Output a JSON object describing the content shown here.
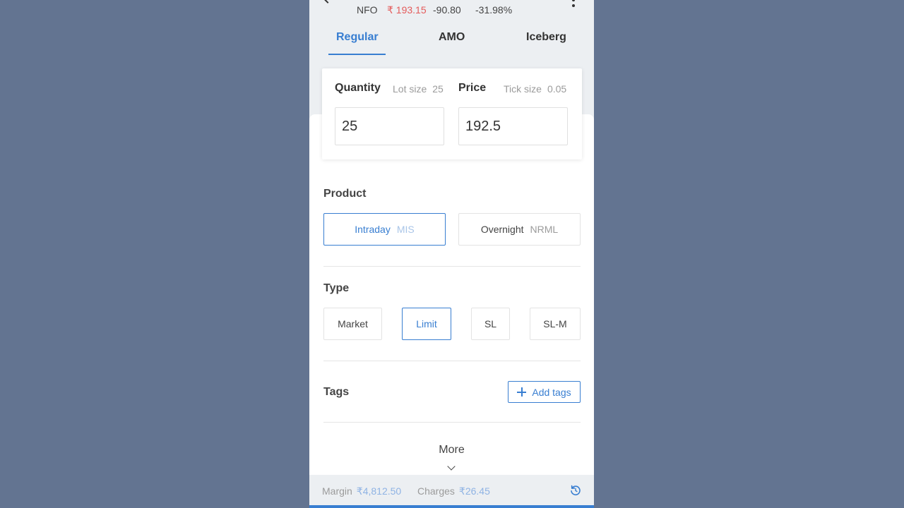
{
  "header": {
    "exchange": "NFO",
    "ltp": "₹ 193.15",
    "change": "-90.80",
    "change_pct": "-31.98%"
  },
  "tabs": [
    {
      "label": "Regular",
      "active": true
    },
    {
      "label": "AMO",
      "active": false
    },
    {
      "label": "Iceberg",
      "active": false
    }
  ],
  "quantity": {
    "label": "Quantity",
    "meta_label": "Lot size",
    "meta_value": "25",
    "value": "25"
  },
  "price": {
    "label": "Price",
    "meta_label": "Tick size",
    "meta_value": "0.05",
    "value": "192.5"
  },
  "product": {
    "label": "Product",
    "options": [
      {
        "label": "Intraday",
        "code": "MIS",
        "selected": true
      },
      {
        "label": "Overnight",
        "code": "NRML",
        "selected": false
      }
    ]
  },
  "type": {
    "label": "Type",
    "options": [
      {
        "label": "Market",
        "selected": false
      },
      {
        "label": "Limit",
        "selected": true
      },
      {
        "label": "SL",
        "selected": false
      },
      {
        "label": "SL-M",
        "selected": false
      }
    ]
  },
  "tags": {
    "label": "Tags",
    "add_label": "Add tags"
  },
  "more": {
    "label": "More"
  },
  "footer": {
    "margin_label": "Margin",
    "margin_value": "₹4,812.50",
    "charges_label": "Charges",
    "charges_value": "₹26.45"
  },
  "colors": {
    "accent": "#387ed1",
    "negative": "#e45b5b",
    "backdrop": "#637491"
  }
}
